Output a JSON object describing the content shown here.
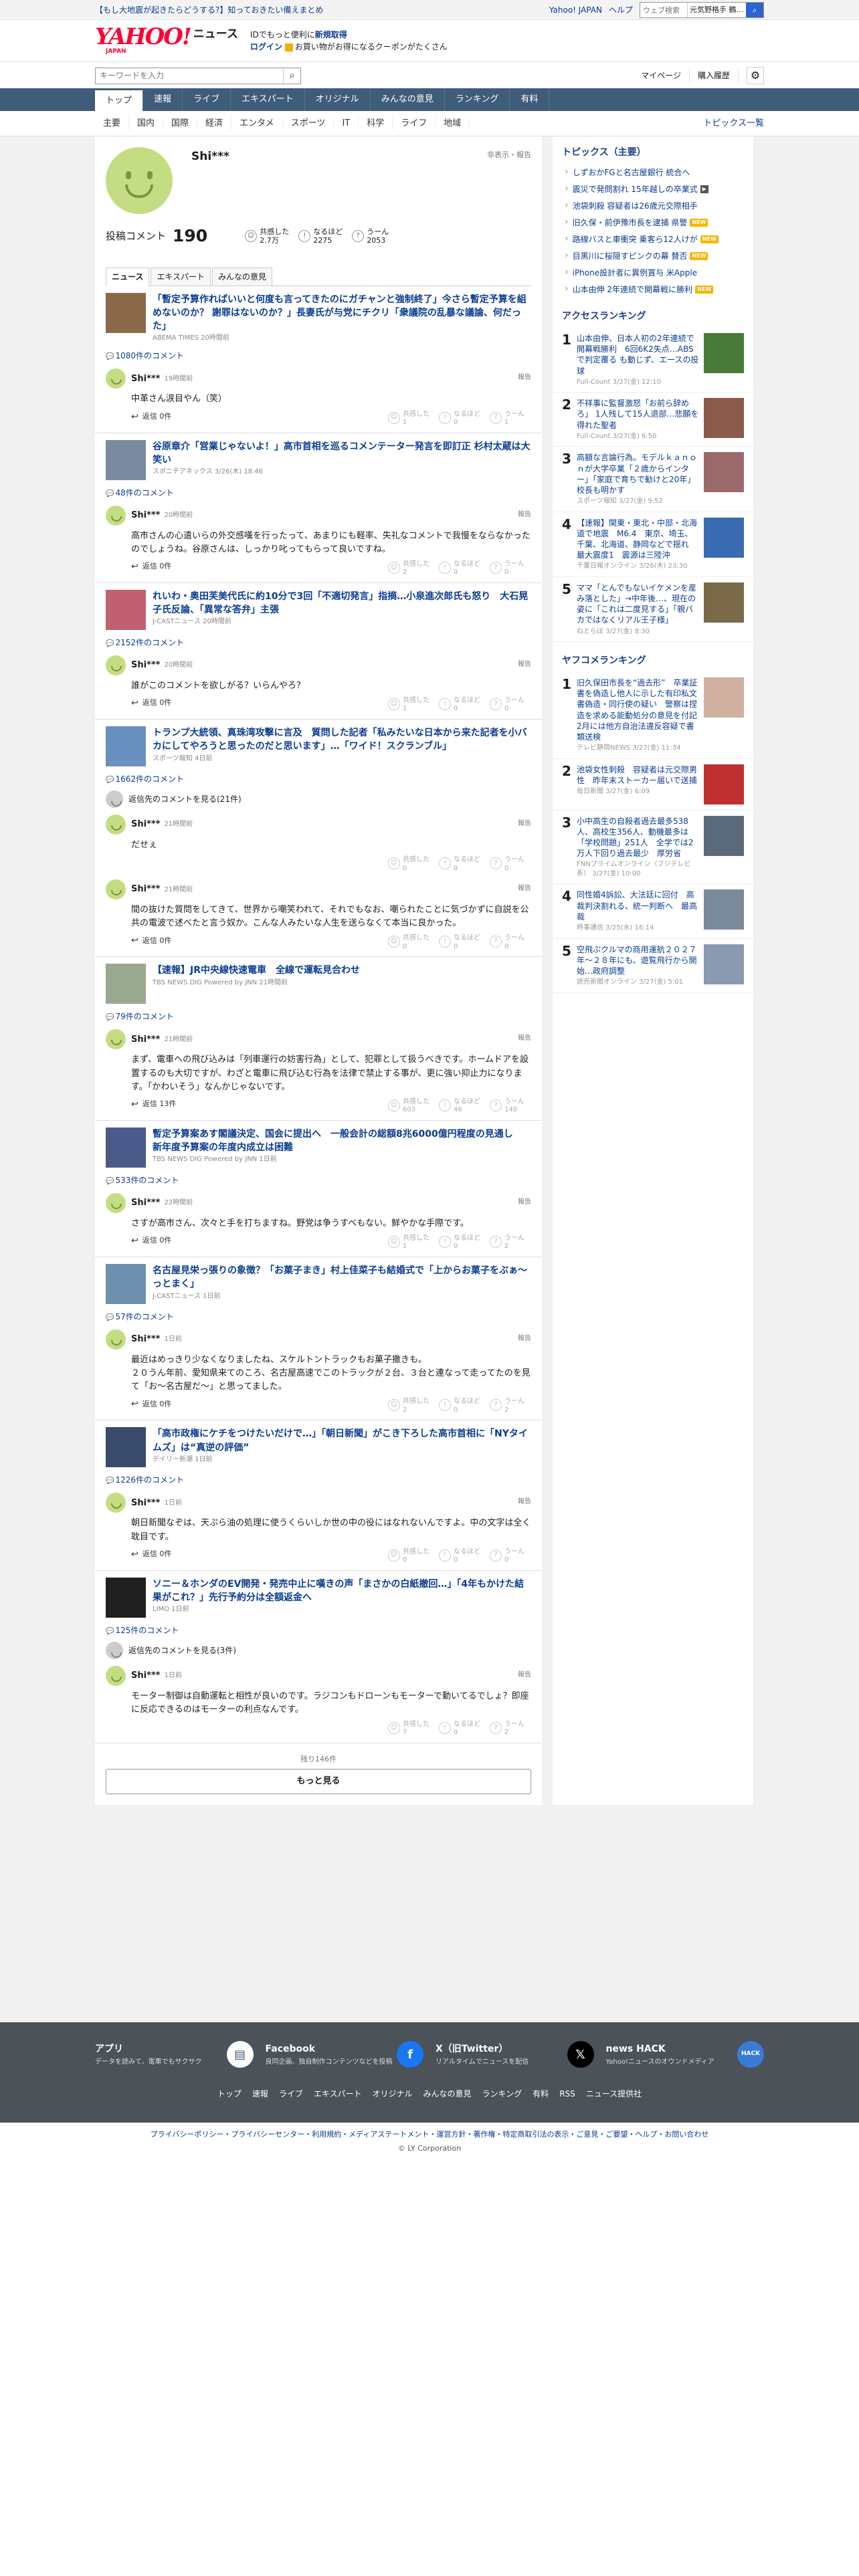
{
  "topbar": {
    "disaster_link": "【もし大地震が起きたらどうする?】知っておきたい備えまとめ",
    "links": [
      "Yahoo! JAPAN",
      "ヘルプ"
    ],
    "search_placeholder": "ウェブ検索",
    "location": "元気野格手 鶴..."
  },
  "header": {
    "logo": "YAHOO!",
    "logo_sub": "JAPAN",
    "service": "ニュース",
    "promo_line1_a": "IDでもっと便利に",
    "promo_line1_b": "新規取得",
    "promo_line2_a": "ログイン",
    "promo_line2_b": "お買い物がお得になるクーポンがたくさん"
  },
  "search": {
    "placeholder": "キーワードを入力",
    "mypage": "マイページ",
    "history": "購入履歴"
  },
  "nav": [
    "トップ",
    "速報",
    "ライブ",
    "エキスパート",
    "オリジナル",
    "みんなの意見",
    "ランキング",
    "有料"
  ],
  "subnav": [
    "主要",
    "国内",
    "国際",
    "経済",
    "エンタメ",
    "スポーツ",
    "IT",
    "科学",
    "ライフ",
    "地域"
  ],
  "subnav_right": "トピックス一覧",
  "profile": {
    "name": "Shi***",
    "meta": "非表示・報告",
    "posted_label": "投稿コメント",
    "posted_count": "190",
    "r1_label": "共感した",
    "r1_val": "2.7万",
    "r2_label": "なるほど",
    "r2_val": "2275",
    "r3_label": "うーん",
    "r3_val": "2053"
  },
  "tabs": [
    "ニュース",
    "エキスパート",
    "みんなの意見"
  ],
  "common": {
    "report": "報告",
    "agree": "共感した",
    "naruhodo": "なるほど",
    "un": "うーん"
  },
  "blocks": [
    {
      "title": "「暫定予算作ればいいと何度も言ってきたのにガチャンと強制終了」今さら暫定予算を組めないのか？ 謝罪はないのか？」長妻氏が与党にチクリ「衆議院の乱暴な議論、何だった」",
      "source": "ABEMA TIMES 20時間前",
      "count": "1080件のコメント",
      "comments": [
        {
          "name": "Shi***",
          "time": "19時間前",
          "text": "中革さん涙目やん（笑）",
          "reply": "返信 0件",
          "a": "1",
          "b": "0",
          "c": "1"
        }
      ]
    },
    {
      "title": "谷原章介「営業じゃないよ！」高市首相を巡るコメンテーター発言を即訂正 杉村太蔵は大笑い",
      "source": "スポニチアネックス 3/26(木) 18:46",
      "count": "48件のコメント",
      "comments": [
        {
          "name": "Shi***",
          "time": "20時間前",
          "text": "高市さんの心遣いらの外交感嘆を行ったって、あまりにも軽率、失礼なコメントで我慢をならなかったのでしょうね。谷原さんは、しっかり叱ってもらって良いですね。",
          "reply": "返信 0件",
          "a": "2",
          "b": "0",
          "c": "0"
        }
      ]
    },
    {
      "title": "れいわ・奥田芙美代氏に約10分で3回「不適切発言」指摘…小泉進次郎氏も怒り　大石晃子氏反論、「異常な答弁」主張",
      "source": "J-CASTニュース 20時間前",
      "count": "2152件のコメント",
      "comments": [
        {
          "name": "Shi***",
          "time": "20時間前",
          "text": "誰がこのコメントを欲しがる？いらんやろ？",
          "reply": "返信 0件",
          "a": "1",
          "b": "0",
          "c": "0"
        }
      ]
    },
    {
      "title": "トランプ大統領、真珠湾攻撃に言及　質問した記者「私みたいな日本から来た記者を小バカにしてやろうと思ったのだと思います」…「ワイド！スクランブル」",
      "source": "スポーツ報知 4日前",
      "count": "1662件のコメント",
      "morereply": "返信先のコメントを見る(21件)",
      "comments": [
        {
          "name": "Shi***",
          "time": "21時間前",
          "text": "だせぇ",
          "reply": "",
          "a": "0",
          "b": "0",
          "c": "0"
        },
        {
          "name": "Shi***",
          "time": "21時間前",
          "text": "間の抜けた質問をしてきて、世界から嘲笑われて、それでもなお、嘲られたことに気づかずに自説を公共の電波で述べたと言う奴か。こんな人みたいな人生を送らなくて本当に良かった。",
          "reply": "返信 0件",
          "a": "0",
          "b": "0",
          "c": "0"
        }
      ]
    },
    {
      "title": "【速報】JR中央線快速電車　全線で運転見合わせ",
      "source": "TBS NEWS DIG Powered by JNN 21時間前",
      "count": "79件のコメント",
      "comments": [
        {
          "name": "Shi***",
          "time": "21時間前",
          "text": "まず、電車への飛び込みは「列車運行の妨害行為」として、犯罪として扱うべきです。ホームドアを設置するのも大切ですが、わざと電車に飛び込む行為を法律で禁止する事が、更に強い抑止力になります。「かわいそう」なんかじゃないです。",
          "reply": "返信 13件",
          "a": "603",
          "b": "46",
          "c": "140"
        }
      ]
    },
    {
      "title": "暫定予算案あす閣議決定、国会に提出へ　一般会計の総額8兆6000億円程度の見通し　新年度予算案の年度内成立は困難",
      "source": "TBS NEWS DIG Powered by JNN 1日前",
      "count": "533件のコメント",
      "comments": [
        {
          "name": "Shi***",
          "time": "22時間前",
          "text": "さすが高市さん、次々と手を打ちますね。野党は争うすべもない。鮮やかな手際です。",
          "reply": "返信 0件",
          "a": "1",
          "b": "0",
          "c": "2"
        }
      ]
    },
    {
      "title": "名古屋見栄っ張りの象徴？「お菓子まき」村上佳菜子も結婚式で「上からお菓子をぶぁ〜っとまく」",
      "source": "J-CASTニュース 1日前",
      "count": "57件のコメント",
      "comments": [
        {
          "name": "Shi***",
          "time": "1日前",
          "text": "最近はめっきり少なくなりましたね、スケルトントラックもお菓子撒きも。\n２０うん年前、愛知県来てのころ、名古屋高速でこのトラックが２台、３台と連なって走ってたのを見て「お〜名古屋だ〜」と思ってました。",
          "reply": "返信 0件",
          "a": "2",
          "b": "0",
          "c": "2"
        }
      ]
    },
    {
      "title": "「高市政権にケチをつけたいだけで…」「朝日新聞」がこき下ろした高市首相に「NYタイムズ」は“真逆の評価”",
      "source": "デイリー新潮 1日前",
      "count": "1226件のコメント",
      "comments": [
        {
          "name": "Shi***",
          "time": "1日前",
          "text": "朝日新聞なぞは、天ぷら油の処理に使うくらいしか世の中の役にはなれないんですよ。中の文字は全く耽目です。",
          "reply": "返信 0件",
          "a": "0",
          "b": "0",
          "c": "0"
        }
      ]
    },
    {
      "title": "ソニー＆ホンダのEV開発・発売中止に嘆きの声「まさかの白紙撤回…」「4年もかけた結果がこれ？」先行予約分は全額返金へ",
      "source": "LIMO 1日前",
      "count": "125件のコメント",
      "morereply": "返信先のコメントを見る(3件)",
      "comments": [
        {
          "name": "Shi***",
          "time": "1日前",
          "text": "モーター制御は自動運転と相性が良いのです。ラジコンもドローンもモーターで動いてるでしょ？即座に反応できるのはモーターの利点なんです。",
          "reply": "",
          "a": "7",
          "b": "0",
          "c": "2"
        }
      ]
    }
  ],
  "more": {
    "rest": "残り146件",
    "button": "もっと見る"
  },
  "side": {
    "topics_title": "トピックス（主要）",
    "topics": [
      {
        "t": "しずおかFGと名古屋銀行 統合へ",
        "b": ""
      },
      {
        "t": "震災で発問割れ 15年越しの卒業式",
        "b": "cam"
      },
      {
        "t": "池袋刺殺 容疑者は26歳元交際相手",
        "b": ""
      },
      {
        "t": "旧久保・前伊豫市長を逮捕 県警",
        "b": "new"
      },
      {
        "t": "路線バスと車衝突 乗客ら12人けが",
        "b": "new"
      },
      {
        "t": "目黒川に桜隠すピンクの幕 賛否",
        "b": "new"
      },
      {
        "t": "iPhone設計者に異例賞与 米Apple",
        "b": ""
      },
      {
        "t": "山本由伸 2年連続で開幕戦に勝利",
        "b": "new"
      }
    ],
    "access_title": "アクセスランキング",
    "access": [
      {
        "t": "山本由伸、日本人初の2年連続で開幕戦勝利　6回6K2失点…ABSで判定覆る も動じず、エースの投球",
        "s": "Full-Count 3/27(金) 12:10"
      },
      {
        "t": "不祥事に監督激怒「お前ら辞めろ」 1人残して15人退部…悲願を得れた聖者",
        "s": "Full-Count 3/27(金) 6:50"
      },
      {
        "t": "高額な言論行為。モデルｋａｎｏｎが大学卒業「２歳からインター」「家庭で育ちで勧けと20年」校長も明かす",
        "s": "スポーツ報知 3/27(金) 9:52"
      },
      {
        "t": "【速報】関東・東北・中部・北海道で地震　M6.4　東京、埼玉、千葉、北海道、静岡などで揺れ　最大震度1　震源は三陸沖",
        "s": "千葉日報オンライン 3/26(木) 23:30"
      },
      {
        "t": "ママ「とんでもないイケメンを産み落とした」→中年後…、現在の姿に「これは二度見する」「親バカではなくリアル王子様」",
        "s": "ねとらぼ 3/27(金) 8:30"
      }
    ],
    "yahoo_title": "ヤフコメランキング",
    "yahoo": [
      {
        "t": "旧久保田市長を“過去形”　卒業証書を偽造し他人に示した有印私文書偽造・同行使の疑い　警察は捏造を求める能動処分の意見を付記2月には他方自治法違反容疑で書類送検",
        "s": "テレビ静岡NEWS 3/27(金) 11:34"
      },
      {
        "t": "池袋女性刺殺　容疑者は元交際男性　昨年末ストーカー届いで送捕",
        "s": "毎日新聞 3/27(金) 6:09"
      },
      {
        "t": "小中高生の自殺者過去最多538人、高校生356人、動機最多は「学校問題」251人　全学では2万人下回り過去最少　厚労省",
        "s": "FNNプライムオンライン（フジテレビ系） 3/27(金) 10:00"
      },
      {
        "t": "同性婚4訴訟、大法廷に回付　高裁判決割れる、統一判断へ　最高裁",
        "s": "時事通信 3/25(水) 16:14"
      },
      {
        "t": "空飛ぶクルマの商用運航２０２７年〜２８年にも、遊覧飛行から開始…政府調整",
        "s": "読売新聞オンライン 3/27(金) 5:01"
      }
    ]
  },
  "footer": {
    "cols": [
      {
        "t": "アプリ",
        "d": "データを読みて、電車でもサクサク"
      },
      {
        "t": "Facebook",
        "d": "良同企画、独自制作コンテンツなどを投稿"
      },
      {
        "t": "X（旧Twitter）",
        "d": "リアルタイムでニュースを配信"
      },
      {
        "t": "news HACK",
        "d": "Yahoo!ニュースのオウンドメディア"
      }
    ],
    "links": [
      "トップ",
      "速報",
      "ライブ",
      "エキスパート",
      "オリジナル",
      "みんなの意見",
      "ランキング",
      "有料",
      "RSS",
      "ニュース提供社"
    ],
    "legal": "プライバシーポリシー・プライバシーセンター・利用規約・メディアステートメント・運営方針・著作権・特定商取引法の表示・ご意見・ご要望・ヘルプ・お問い合わせ",
    "copy": "© LY Corporation"
  }
}
